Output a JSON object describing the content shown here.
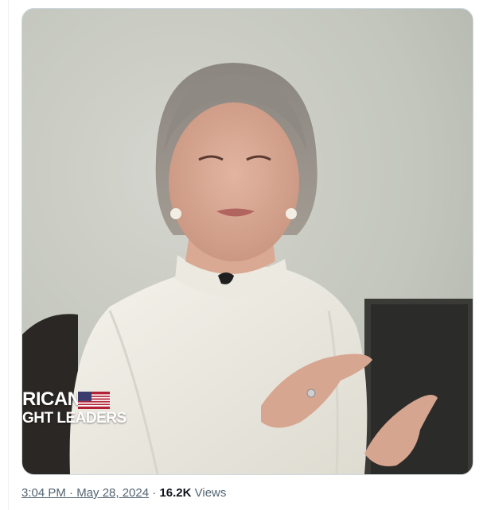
{
  "media": {
    "overlay_line1": "RICAN",
    "overlay_line2": "GHT LEADERS",
    "flag_icon": "us-flag-icon"
  },
  "meta": {
    "timestamp": "3:04 PM · May 28, 2024",
    "separator": " · ",
    "views_count": "16.2K",
    "views_label": " Views"
  },
  "colors": {
    "meta_text": "#536471",
    "views_count": "#0f1419",
    "border": "#cfd9de"
  }
}
